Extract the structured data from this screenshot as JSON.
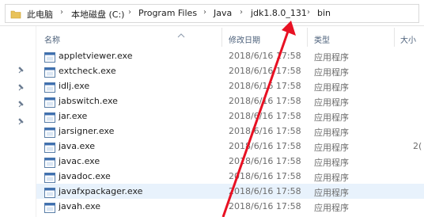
{
  "address_bar": {
    "crumbs": [
      "此电脑",
      "本地磁盘 (C:)",
      "Program Files",
      "Java",
      "jdk1.8.0_131",
      "bin"
    ]
  },
  "columns": {
    "name": "名称",
    "modified": "修改日期",
    "type": "类型",
    "size": "大小"
  },
  "files": [
    {
      "name": "appletviewer.exe",
      "date": "2018/6/16 17:58",
      "type": "应用程序",
      "size": ""
    },
    {
      "name": "extcheck.exe",
      "date": "2018/6/16 17:58",
      "type": "应用程序",
      "size": ""
    },
    {
      "name": "idlj.exe",
      "date": "2018/6/16 17:58",
      "type": "应用程序",
      "size": ""
    },
    {
      "name": "jabswitch.exe",
      "date": "2018/6/16 17:58",
      "type": "应用程序",
      "size": ""
    },
    {
      "name": "jar.exe",
      "date": "2018/6/16 17:58",
      "type": "应用程序",
      "size": ""
    },
    {
      "name": "jarsigner.exe",
      "date": "2018/6/16 17:58",
      "type": "应用程序",
      "size": ""
    },
    {
      "name": "java.exe",
      "date": "2018/6/16 17:58",
      "type": "应用程序",
      "size": "2("
    },
    {
      "name": "javac.exe",
      "date": "2018/6/16 17:58",
      "type": "应用程序",
      "size": ""
    },
    {
      "name": "javadoc.exe",
      "date": "2018/6/16 17:58",
      "type": "应用程序",
      "size": ""
    },
    {
      "name": "javafxpackager.exe",
      "date": "2018/6/16 17:58",
      "type": "应用程序",
      "size": ""
    },
    {
      "name": "javah.exe",
      "date": "2018/6/16 17:58",
      "type": "应用程序",
      "size": ""
    }
  ],
  "highlighted_row": 9,
  "colors": {
    "accent": "#e81123",
    "header_text": "#4c607a",
    "highlight": "#e8f2fc"
  }
}
